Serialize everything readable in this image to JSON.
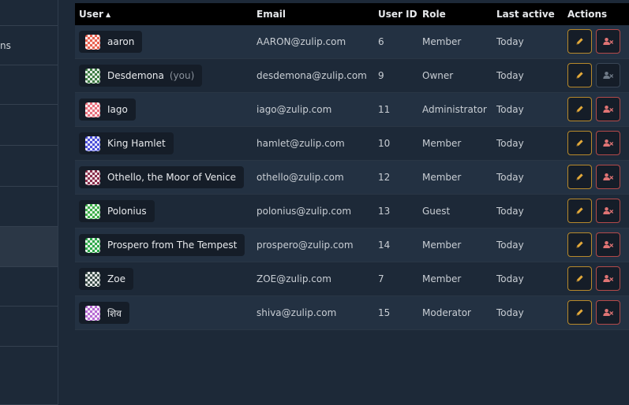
{
  "sidebar": {
    "items": [
      {
        "label": "",
        "active": false
      },
      {
        "label": "ns",
        "active": false
      },
      {
        "label": "",
        "active": false
      },
      {
        "label": "",
        "active": false
      },
      {
        "label": "",
        "active": false
      },
      {
        "label": "",
        "active": false
      },
      {
        "label": "",
        "active": true
      },
      {
        "label": "",
        "active": false
      },
      {
        "label": "",
        "active": false
      },
      {
        "label": "",
        "active": false
      }
    ]
  },
  "table": {
    "headers": {
      "user": "User",
      "email": "Email",
      "user_id": "User ID",
      "role": "Role",
      "last_active": "Last active",
      "actions": "Actions"
    },
    "sort_indicator": "▲",
    "rows": [
      {
        "name": "aaron",
        "you": "",
        "email": "AARON@zulip.com",
        "id": "6",
        "role": "Member",
        "last_active": "Today",
        "avatar_color": "#e8614f",
        "deactivate_enabled": true
      },
      {
        "name": "Desdemona",
        "you": "(you)",
        "email": "desdemona@zulip.com",
        "id": "9",
        "role": "Owner",
        "last_active": "Today",
        "avatar_color": "#3f7d44",
        "deactivate_enabled": false
      },
      {
        "name": "Iago",
        "you": "",
        "email": "iago@zulip.com",
        "id": "11",
        "role": "Administrator",
        "last_active": "Today",
        "avatar_color": "#e96f7d",
        "deactivate_enabled": true
      },
      {
        "name": "King Hamlet",
        "you": "",
        "email": "hamlet@zulip.com",
        "id": "10",
        "role": "Member",
        "last_active": "Today",
        "avatar_color": "#4a4fd8",
        "deactivate_enabled": true
      },
      {
        "name": "Othello, the Moor of Venice",
        "you": "",
        "email": "othello@zulip.com",
        "id": "12",
        "role": "Member",
        "last_active": "Today",
        "avatar_color": "#8a2e4c",
        "deactivate_enabled": true
      },
      {
        "name": "Polonius",
        "you": "",
        "email": "polonius@zulip.com",
        "id": "13",
        "role": "Guest",
        "last_active": "Today",
        "avatar_color": "#3fae4a",
        "deactivate_enabled": true
      },
      {
        "name": "Prospero from The Tempest",
        "you": "",
        "email": "prospero@zulip.com",
        "id": "14",
        "role": "Member",
        "last_active": "Today",
        "avatar_color": "#2ea84a",
        "deactivate_enabled": true
      },
      {
        "name": "Zoe",
        "you": "",
        "email": "ZOE@zulip.com",
        "id": "7",
        "role": "Member",
        "last_active": "Today",
        "avatar_color": "#3d4f4a",
        "deactivate_enabled": true
      },
      {
        "name": "शिव",
        "you": "",
        "email": "shiva@zulip.com",
        "id": "15",
        "role": "Moderator",
        "last_active": "Today",
        "avatar_color": "#b66ad2",
        "deactivate_enabled": true
      }
    ]
  },
  "colors": {
    "edit_accent": "#e3a93a",
    "deactivate_accent": "#e07474",
    "disabled_icon": "#6f7a87"
  },
  "icons": {
    "edit": "pencil-icon",
    "deactivate": "user-times-icon"
  }
}
